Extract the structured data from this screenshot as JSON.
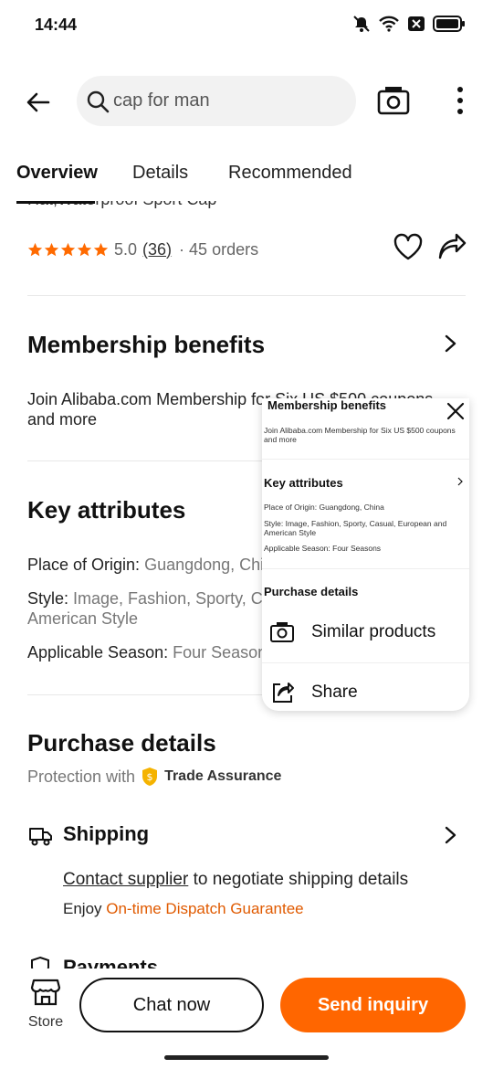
{
  "status": {
    "time": "14:44"
  },
  "search": {
    "query": "cap for man"
  },
  "tabs": [
    {
      "label": "Overview"
    },
    {
      "label": "Details"
    },
    {
      "label": "Recommended"
    }
  ],
  "product": {
    "title_fragment": "Hat,Waterproof Sport Cap",
    "rating": "5.0",
    "review_count": "(36)",
    "orders": "· 45 orders"
  },
  "membership": {
    "title": "Membership benefits",
    "text_prefix": "Join Alibaba.com Membership for ",
    "text_highlight": "Six US $500 coupons",
    "text_suffix": " and more"
  },
  "key_attributes": {
    "title": "Key attributes",
    "origin_label": "Place of Origin: ",
    "origin_value": "Guangdong, China",
    "style_label": "Style: ",
    "style_value": "Image, Fashion, Sporty, Casual, European and American Style",
    "season_label": "Applicable Season: ",
    "season_value": "Four Seasons"
  },
  "purchase": {
    "title": "Purchase details",
    "protection": "Protection with",
    "trade_assurance": "Trade Assurance",
    "shipping_title": "Shipping",
    "contact_link": "Contact supplier",
    "contact_suffix": " to negotiate shipping details",
    "enjoy": "Enjoy ",
    "dispatch": "On-time Dispatch Guarantee",
    "payments_title": "Payments"
  },
  "popup": {
    "preview_membership_title": "Membership benefits",
    "preview_membership_text": "Join Alibaba.com Membership for Six US $500 coupons and more",
    "preview_key_title": "Key attributes",
    "preview_origin": "Place of Origin: Guangdong, China",
    "preview_style": "Style: Image, Fashion, Sporty, Casual, European and American Style",
    "preview_season": "Applicable Season: Four Seasons",
    "preview_purchase_title": "Purchase details",
    "similar_label": "Similar products",
    "share_label": "Share"
  },
  "bottom": {
    "store_label": "Store",
    "chat_label": "Chat now",
    "inquiry_label": "Send inquiry"
  },
  "colors": {
    "accent": "#ff6600",
    "star": "#ff6a00",
    "link_orange": "#e05a00"
  }
}
